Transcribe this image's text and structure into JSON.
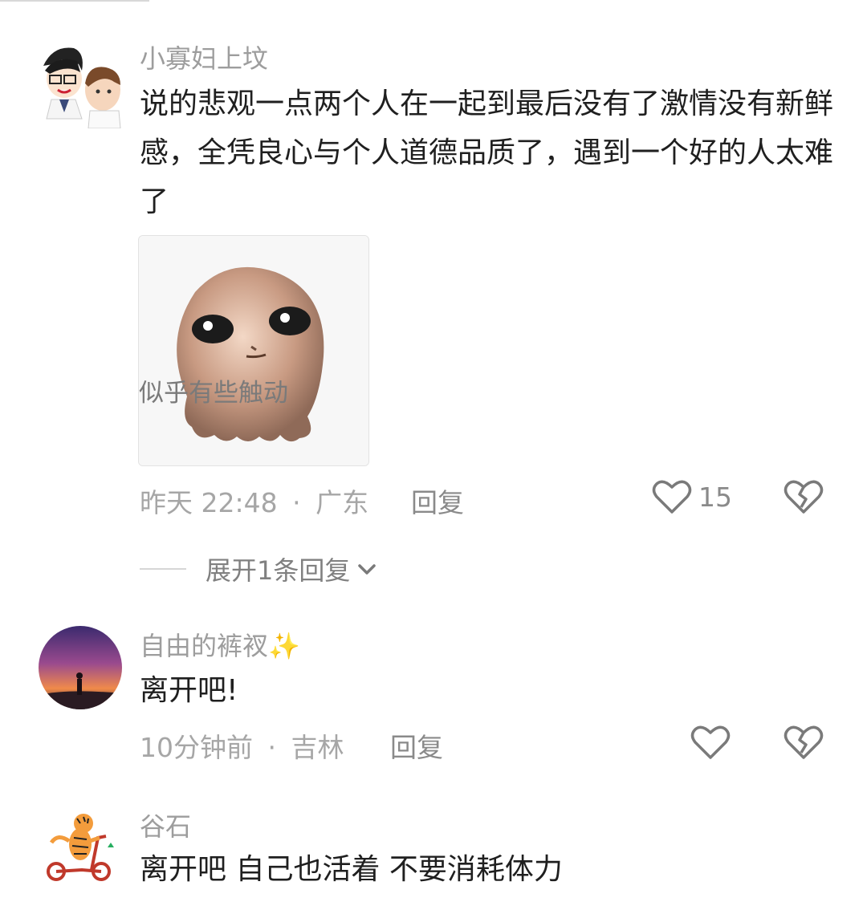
{
  "comments": [
    {
      "username": "小寡妇上坟",
      "text": "说的悲观一点两个人在一起到最后没有了激情没有新鲜感，全凭良心与个人道德品质了，遇到一个好的人太难了",
      "sticker_caption": "似乎有些触动",
      "time": "昨天 22:48",
      "location": "广东",
      "reply_label": "回复",
      "likes": "15"
    },
    {
      "username": "自由的裤衩",
      "username_emoji": "✨",
      "text": "离开吧!",
      "time": "10分钟前",
      "location": "吉林",
      "reply_label": "回复"
    },
    {
      "username": "谷石",
      "text": "离开吧 自己也活着 不要消耗体力"
    }
  ],
  "expand_replies": "展开1条回复",
  "meta_separator": "·",
  "icons": {
    "like": "heart-outline-icon",
    "dislike": "broken-heart-icon",
    "expand": "chevron-down-icon"
  },
  "colors": {
    "text_primary": "#1f1f1f",
    "text_secondary": "#9d9d9d",
    "icon_gray": "#7a7a7a"
  }
}
